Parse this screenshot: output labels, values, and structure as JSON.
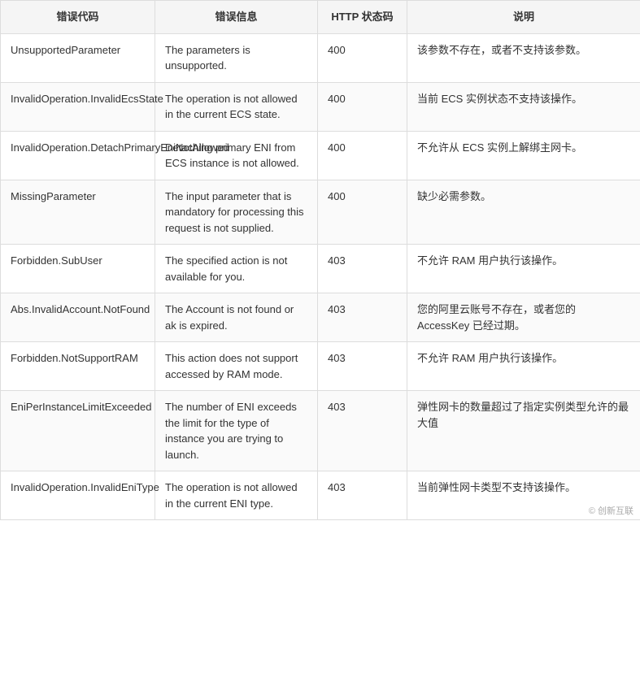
{
  "table": {
    "headers": [
      "错误代码",
      "错误信息",
      "HTTP 状态码",
      "说明"
    ],
    "rows": [
      {
        "code": "UnsupportedParameter",
        "message": "The parameters is unsupported.",
        "http": "400",
        "description": "该参数不存在，或者不支持该参数。"
      },
      {
        "code": "InvalidOperation.InvalidEcsState",
        "message": "The operation is not allowed in the current ECS state.",
        "http": "400",
        "description": "当前 ECS 实例状态不支持该操作。"
      },
      {
        "code": "InvalidOperation.DetachPrimaryEniNotAllowed",
        "message": "Detaching primary ENI from ECS instance is not allowed.",
        "http": "400",
        "description": "不允许从 ECS 实例上解绑主网卡。"
      },
      {
        "code": "MissingParameter",
        "message": "The input parameter that is mandatory for processing this request is not supplied.",
        "http": "400",
        "description": "缺少必需参数。"
      },
      {
        "code": "Forbidden.SubUser",
        "message": "The specified action is not available for you.",
        "http": "403",
        "description": "不允许 RAM 用户执行该操作。"
      },
      {
        "code": "Abs.InvalidAccount.NotFound",
        "message": "The Account is not found or ak is expired.",
        "http": "403",
        "description": "您的阿里云账号不存在，或者您的 AccessKey 已经过期。"
      },
      {
        "code": "Forbidden.NotSupportRAM",
        "message": "This action does not support accessed by RAM mode.",
        "http": "403",
        "description": "不允许 RAM 用户执行该操作。"
      },
      {
        "code": "EniPerInstanceLimitExceeded",
        "message": "The number of ENI exceeds the limit for the type of instance you are trying to launch.",
        "http": "403",
        "description": "弹性网卡的数量超过了指定实例类型允许的最大值"
      },
      {
        "code": "InvalidOperation.InvalidEniType",
        "message": "The operation is not allowed in the current ENI type.",
        "http": "403",
        "description": "当前弹性网卡类型不支持该操作。"
      }
    ]
  },
  "watermark": "© 创新互联"
}
